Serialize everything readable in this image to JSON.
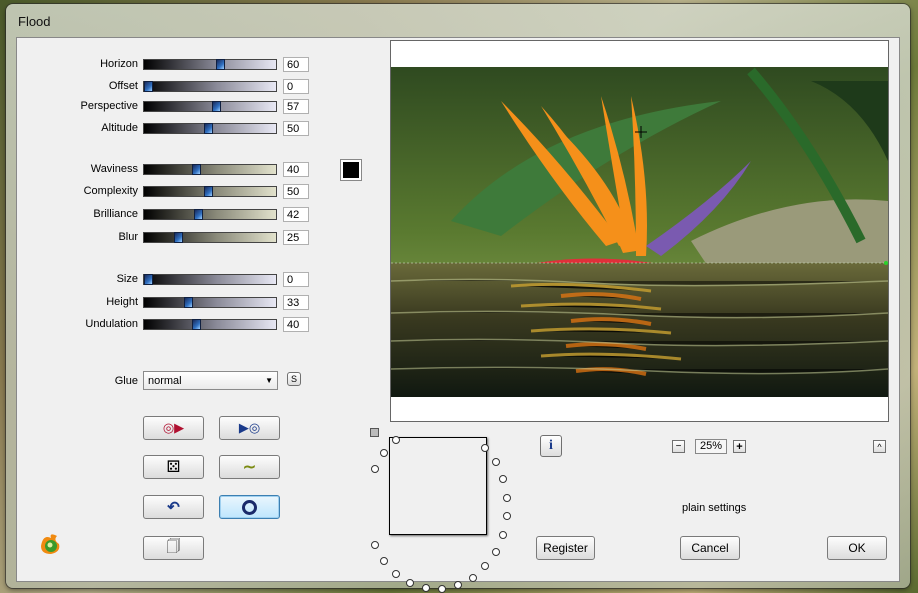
{
  "window": {
    "title": "Flood"
  },
  "sliders": [
    {
      "label": "Horizon",
      "value": "60",
      "fraction": 0.6,
      "grad": "gray"
    },
    {
      "label": "Offset",
      "value": "0",
      "fraction": 0.0,
      "grad": "gray"
    },
    {
      "label": "Perspective",
      "value": "57",
      "fraction": 0.57,
      "grad": "gray"
    },
    {
      "label": "Altitude",
      "value": "50",
      "fraction": 0.5,
      "grad": "gray"
    },
    {
      "label": "Waviness",
      "value": "40",
      "fraction": 0.4,
      "grad": "olive"
    },
    {
      "label": "Complexity",
      "value": "50",
      "fraction": 0.5,
      "grad": "olive"
    },
    {
      "label": "Brilliance",
      "value": "42",
      "fraction": 0.42,
      "grad": "olive"
    },
    {
      "label": "Blur",
      "value": "25",
      "fraction": 0.25,
      "grad": "olive"
    },
    {
      "label": "Size",
      "value": "0",
      "fraction": 0.0,
      "grad": "gray"
    },
    {
      "label": "Height",
      "value": "33",
      "fraction": 0.33,
      "grad": "gray"
    },
    {
      "label": "Undulation",
      "value": "40",
      "fraction": 0.4,
      "grad": "gray"
    }
  ],
  "color_swatch": "#000000",
  "glue": {
    "label": "Glue",
    "selected": "normal",
    "sync_label": "S"
  },
  "preview": {
    "zoom": "25%",
    "zoom_minus": "−",
    "zoom_plus": "+",
    "info_label": "i",
    "collapse_label": "^"
  },
  "presets": {
    "status": "plain settings"
  },
  "buttons": {
    "register": "Register",
    "cancel": "Cancel",
    "ok": "OK"
  }
}
